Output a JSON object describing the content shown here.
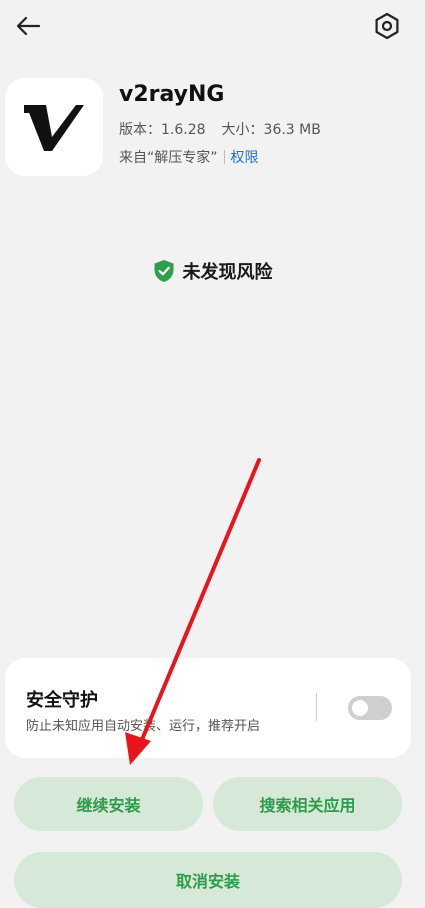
{
  "header": {
    "back_icon": "arrow-left-icon",
    "settings_icon": "hexagon-gear-icon"
  },
  "app": {
    "name": "v2rayNG",
    "version_text": "版本：1.6.28",
    "size_text": "大小：36.3 MB",
    "source_text": "来自“解压专家”",
    "permissions_link": "权限",
    "icon": "v2rayng-logo-icon"
  },
  "status": {
    "text": "未发现风险",
    "icon": "shield-check-icon",
    "color": "#2e9e4f"
  },
  "security_card": {
    "title": "安全守护",
    "description": "防止未知应用自动安装、运行，推荐开启",
    "toggle_on": false
  },
  "buttons": {
    "continue_install": "继续安装",
    "search_related": "搜索相关应用",
    "cancel_install": "取消安装"
  },
  "colors": {
    "accent_green": "#2d9c49",
    "button_bg": "#d6e9d9",
    "link_blue": "#1f6fd6",
    "annotation_arrow": "#e8161c"
  }
}
